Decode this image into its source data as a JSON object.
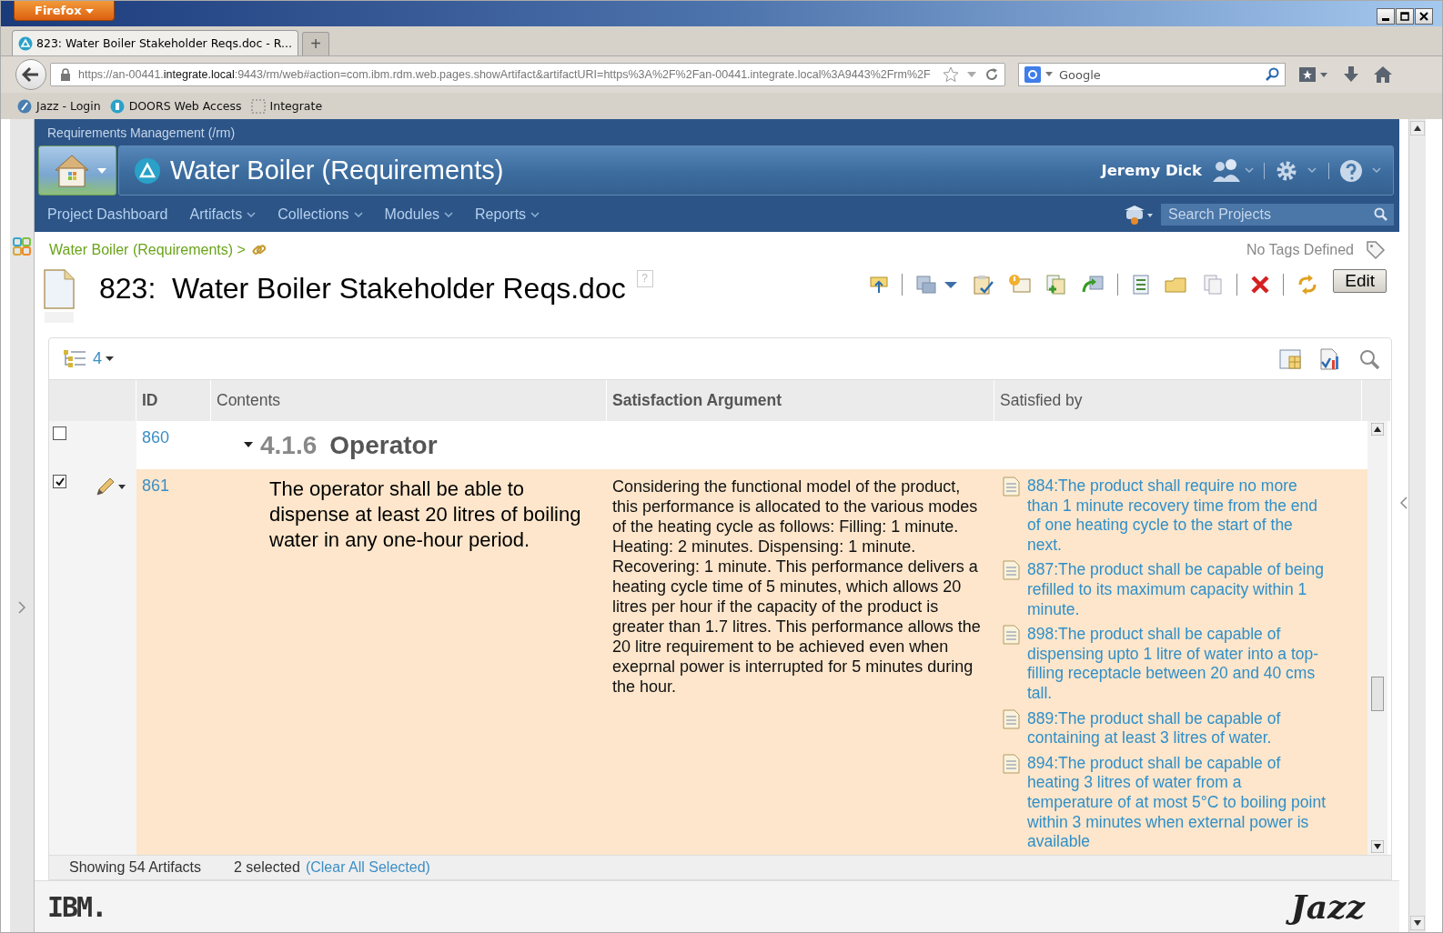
{
  "browser": {
    "menu_button": "Firefox",
    "tab": {
      "title": "823: Water Boiler Stakeholder Reqs.doc - R...",
      "selected": true
    },
    "new_tab": "+",
    "url": {
      "prefix": "https://an-00441.",
      "host": "integrate.local",
      "rest": ":9443/rm/web#action=com.ibm.rdm.web.pages.showArtifact&artifactURI=https%3A%2F%2Fan-00441.integrate.local%3A9443%2Frm%2F"
    },
    "search": {
      "placeholder": "Google"
    },
    "bookmarks": [
      {
        "label": "Jazz - Login",
        "kind": "jazz"
      },
      {
        "label": "DOORS Web Access",
        "kind": "doors"
      },
      {
        "label": "Integrate",
        "kind": "blank"
      }
    ]
  },
  "app": {
    "product": "Requirements Management (/rm)",
    "project": "Water Boiler (Requirements)",
    "user": "Jeremy Dick",
    "menu": [
      {
        "label": "Project Dashboard",
        "has_menu": false
      },
      {
        "label": "Artifacts",
        "has_menu": true
      },
      {
        "label": "Collections",
        "has_menu": true
      },
      {
        "label": "Modules",
        "has_menu": true
      },
      {
        "label": "Reports",
        "has_menu": true
      }
    ],
    "search": {
      "placeholder": "Search Projects"
    }
  },
  "breadcrumb": "Water Boiler (Requirements) >",
  "tags": "No Tags Defined",
  "artifact": {
    "title": "823:  Water Boiler Stakeholder Reqs.doc",
    "help": "?",
    "edit": "Edit"
  },
  "view": {
    "level": "4"
  },
  "table": {
    "columns": [
      "ID",
      "Contents",
      "Satisfaction Argument",
      "Satisfied by"
    ],
    "rows": [
      {
        "kind": "heading",
        "checked": false,
        "id": "860",
        "number": "4.1.6",
        "title": "Operator"
      },
      {
        "kind": "requirement",
        "checked": true,
        "id": "861",
        "text": "The operator shall be able to dispense at least 20 litres of boiling water in any one-hour period.",
        "argument": "Considering the functional model of the product, this performance is allocated to the various modes of the heating cycle as follows: Filling: 1 minute. Heating: 2 minutes. Dispensing: 1 minute. Recovering: 1 minute. This performance delivers a heating cycle time of 5 minutes, which allows 20 litres per hour if the capacity of the product is greater than 1.7 litres. This performance allows the 20 litre requirement to be achieved even when exeprnal power is interrupted for 5 minutes during the hour.",
        "satisfied_by": [
          "884:The product shall require no more than 1 minute recovery time from the end of one heating cycle to the start of the next.",
          "887:The product shall be capable of being refilled to its maximum capacity within 1 minute.",
          "898:The product shall be capable of dispensing upto 1 litre of water into a top-filling receptacle between 20 and 40 cms tall.",
          "889:The product shall be capable of containing at least 3 litres of water.",
          "894:The product shall be capable of heating 3 litres of water from a temperature of at most 5°C to boiling point within 3 minutes when external power is available"
        ]
      }
    ]
  },
  "status": {
    "showing": "Showing 54 Artifacts",
    "selected": "2 selected",
    "clear": "(Clear All Selected)"
  },
  "footer": {
    "ibm": "IBM.",
    "jazz": "Jazz"
  }
}
